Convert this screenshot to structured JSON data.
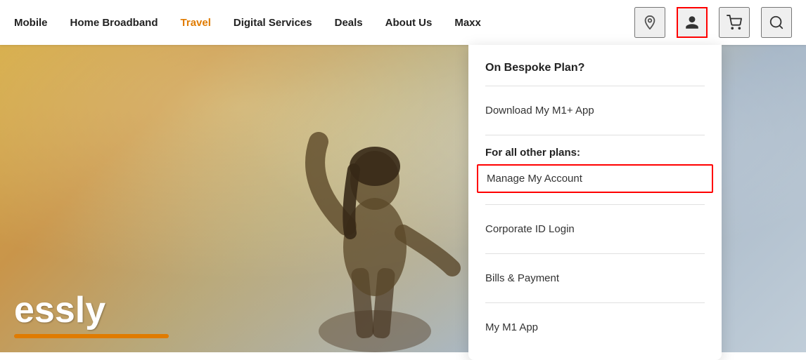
{
  "header": {
    "nav": [
      {
        "label": "Mobile",
        "active": false,
        "key": "mobile"
      },
      {
        "label": "Home Broadband",
        "active": false,
        "key": "home-broadband"
      },
      {
        "label": "Travel",
        "active": true,
        "key": "travel"
      },
      {
        "label": "Digital Services",
        "active": false,
        "key": "digital-services"
      },
      {
        "label": "Deals",
        "active": false,
        "key": "deals"
      },
      {
        "label": "About Us",
        "active": false,
        "key": "about-us"
      },
      {
        "label": "Maxx",
        "active": false,
        "key": "maxx"
      }
    ]
  },
  "hero": {
    "text": "essly"
  },
  "dropdown": {
    "bespoke_title": "On Bespoke Plan?",
    "download_label": "Download My M1+ App",
    "other_plans_title": "For all other plans:",
    "links": [
      {
        "label": "Manage My Account",
        "key": "manage-account",
        "highlighted": true
      },
      {
        "label": "Corporate ID Login",
        "key": "corporate-id-login",
        "highlighted": false
      },
      {
        "label": "Bills & Payment",
        "key": "bills-payment",
        "highlighted": false
      },
      {
        "label": "My M1 App",
        "key": "my-m1-app",
        "highlighted": false
      }
    ]
  },
  "icons": {
    "location": "📍",
    "person": "👤",
    "cart": "🛒",
    "search": "🔍"
  }
}
